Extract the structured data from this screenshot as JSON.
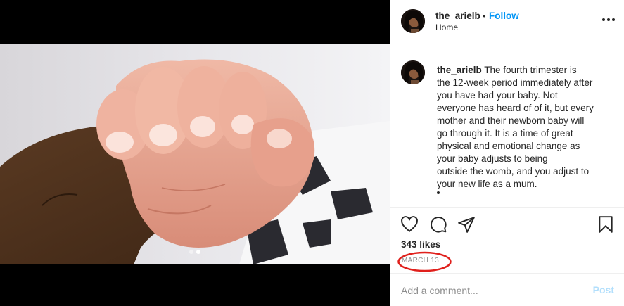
{
  "media": {
    "carousel_dot_count": 2,
    "carousel_active_index": 1
  },
  "header": {
    "username": "the_arielb",
    "separator": "•",
    "follow_label": "Follow",
    "location": "Home",
    "more_icon": "more-horizontal-icon"
  },
  "caption": {
    "username": "the_arielb",
    "text": " The fourth trimester is\nthe 12-week period immediately after\nyou have had your baby. Not\neveryone has heard of of it, but every\nmother and their newborn baby will\ngo through it. It is a time of great\nphysical and emotional change as\nyour baby adjusts to being\noutside the womb, and you adjust to\nyour new life as a mum."
  },
  "actions": {
    "icons": [
      "heart-icon",
      "comment-icon",
      "share-icon",
      "bookmark-icon"
    ],
    "likes_label": "343 likes",
    "date_label": "MARCH 13",
    "highlight_color": "#e0201c"
  },
  "comment": {
    "placeholder": "Add a comment...",
    "post_label": "Post"
  },
  "colors": {
    "follow": "#0095f6",
    "post_disabled": "#b2dffc",
    "secondary_text": "#8e8e8e",
    "text": "#262626"
  }
}
